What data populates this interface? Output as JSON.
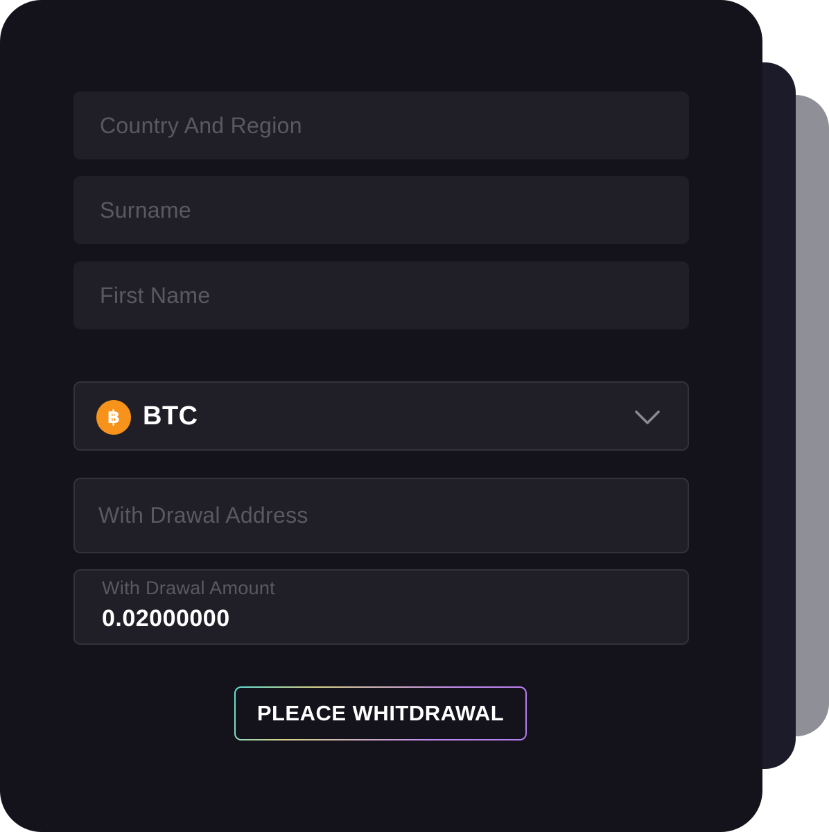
{
  "form": {
    "country_placeholder": "Country And Region",
    "surname_placeholder": "Surname",
    "first_name_placeholder": "First Name",
    "currency": {
      "selected": "BTC",
      "icon": "bitcoin-icon",
      "icon_glyph": "฿",
      "icon_color": "#f7931a"
    },
    "withdrawal_address_placeholder": "With Drawal Address",
    "withdrawal_amount_label": "With Drawal Amount",
    "withdrawal_amount_value": "0.02000000",
    "submit_label": "PLEACE WHITDRAWAL"
  },
  "colors": {
    "card_background": "#14121b",
    "field_background": "#201f27",
    "placeholder_text": "#5a5962",
    "bitcoin_orange": "#f7931a"
  }
}
